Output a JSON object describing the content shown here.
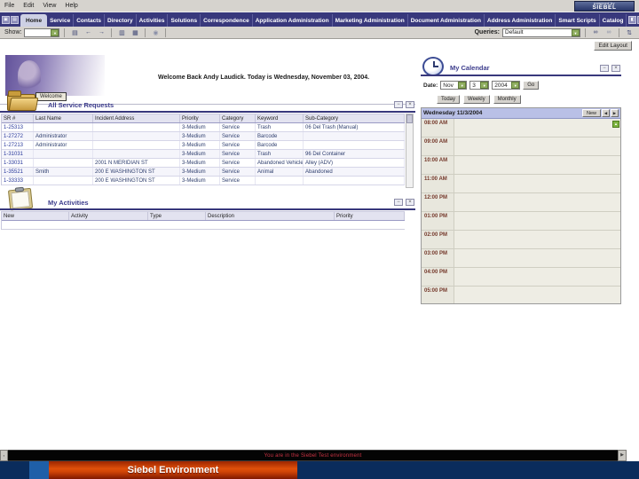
{
  "menu": {
    "items": [
      "File",
      "Edit",
      "View",
      "Help"
    ]
  },
  "logo": {
    "line1": "powered by",
    "line2": "SIEBEL"
  },
  "tabs": {
    "active": "Home",
    "items": [
      "Home",
      "Service",
      "Contacts",
      "Directory",
      "Activities",
      "Solutions",
      "Correspondence",
      "Application Administration",
      "Marketing Administration",
      "Document Administration",
      "Address Administration",
      "Smart Scripts",
      "Catalog"
    ]
  },
  "toolbar": {
    "show_label": "Show:",
    "show_value": "",
    "queries_label": "Queries:",
    "queries_value": "Default",
    "edit_layout_label": "Edit Layout"
  },
  "welcome": {
    "message": "Welcome Back Andy Laudick.  Today is Wednesday, November 03, 2004.",
    "button_label": "Welcome"
  },
  "service_requests": {
    "title": "All Service Requests",
    "columns": [
      "SR #",
      "Last Name",
      "Incident Address",
      "Priority",
      "Category",
      "Keyword",
      "Sub-Category"
    ],
    "rows": [
      [
        "1-25313",
        "",
        "",
        "3-Medium",
        "Service",
        "Trash",
        "06 Del Trash (Manual)"
      ],
      [
        "1-27272",
        "Administrator",
        "",
        "3-Medium",
        "Service",
        "Barcode",
        ""
      ],
      [
        "1-27213",
        "Administrator",
        "",
        "3-Medium",
        "Service",
        "Barcode",
        ""
      ],
      [
        "1-31031",
        "",
        "",
        "3-Medium",
        "Service",
        "Trash",
        "96 Del Container"
      ],
      [
        "1-33031",
        "",
        "2001 N MERIDIAN ST",
        "3-Medium",
        "Service",
        "Abandoned Vehicle",
        "Alley (ADV)"
      ],
      [
        "1-35521",
        "Smith",
        "200 E WASHINGTON ST",
        "3-Medium",
        "Service",
        "Animal",
        "Abandoned"
      ],
      [
        "1-33333",
        "",
        "200 E WASHINGTON ST",
        "3-Medium",
        "Service",
        "",
        ""
      ]
    ]
  },
  "activities": {
    "title": "My Activities",
    "columns": [
      "New",
      "Activity",
      "Type",
      "Description",
      "Priority"
    ],
    "rows": []
  },
  "calendar": {
    "title": "My Calendar",
    "date_label": "Date:",
    "month": "Nov",
    "day": "3",
    "year": "2004",
    "go_label": "Go",
    "view_buttons": [
      "Today",
      "Weekly",
      "Monthly"
    ],
    "day_header": "Wednesday 11/3/2004",
    "new_label": "New",
    "times": [
      "08:00 AM",
      "09:00 AM",
      "10:00 AM",
      "11:00 AM",
      "12:00 PM",
      "01:00 PM",
      "02:00 PM",
      "03:00 PM",
      "04:00 PM",
      "05:00 PM"
    ]
  },
  "status": {
    "message": "You are in the Siebel Test environment"
  },
  "caption": {
    "label": "Siebel Environment"
  },
  "icons": {
    "minimize": "−",
    "close": "×",
    "dropdown_arrow": "▼",
    "history": "▤",
    "back": "←",
    "forward": "→",
    "new_record": "▥",
    "copy_record": "▦",
    "query": "◉",
    "binoculars": "∞",
    "saved_query": "∞",
    "sort": "⇅",
    "app": "▣",
    "screens": "▤",
    "tab_more1": "◧",
    "tab_more2": "▸",
    "prev": "◀",
    "next": "▶",
    "scroll_up": "▲",
    "status_left": "▪",
    "status_right": "▶"
  },
  "colors": {
    "tab_bar": "#38387c",
    "section_accent": "#3c3c8c",
    "table_header": "#e3e3f0",
    "calendar_day_header": "#b9c0e6",
    "caption_orange": "#d9490e",
    "slide_navy": "#0a2c5c",
    "status_red": "#cc3344"
  }
}
